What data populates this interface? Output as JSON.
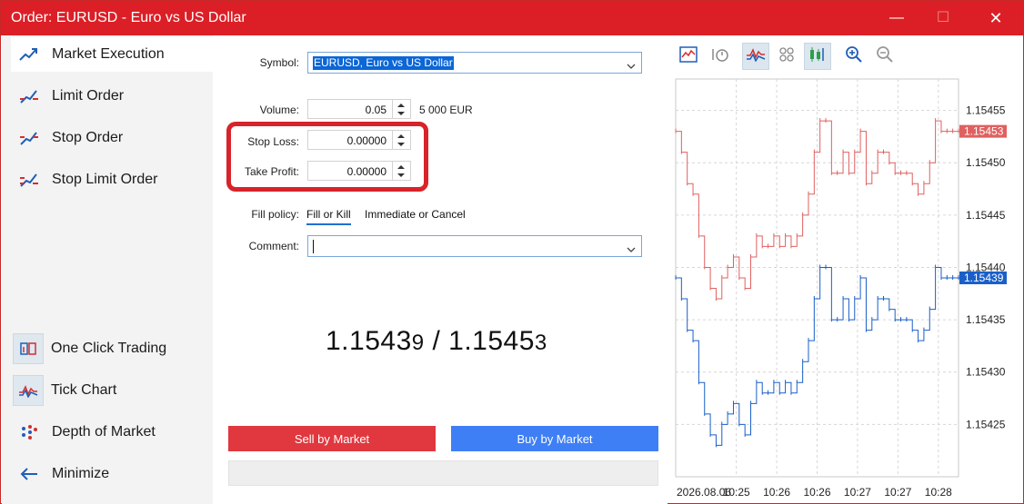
{
  "window": {
    "title": "Order: EURUSD - Euro vs US Dollar",
    "min_glyph": "—",
    "max_glyph": "☐",
    "close_glyph": "✕"
  },
  "sidebar": {
    "items": [
      {
        "label": "Market Execution",
        "icon": "market-execution-icon"
      },
      {
        "label": "Limit Order",
        "icon": "limit-order-icon"
      },
      {
        "label": "Stop Order",
        "icon": "stop-order-icon"
      },
      {
        "label": "Stop Limit Order",
        "icon": "stop-limit-order-icon"
      }
    ],
    "bottom_items": [
      {
        "label": "One Click Trading",
        "icon": "one-click-trading-icon"
      },
      {
        "label": "Tick Chart",
        "icon": "tick-chart-icon"
      },
      {
        "label": "Depth of Market",
        "icon": "depth-of-market-icon"
      },
      {
        "label": "Minimize",
        "icon": "arrow-left-icon"
      }
    ]
  },
  "form": {
    "symbol_label": "Symbol:",
    "symbol_value": "EURUSD, Euro vs US Dollar",
    "volume_label": "Volume:",
    "volume_value": "0.05",
    "volume_note": "5 000 EUR",
    "stop_loss_label": "Stop Loss:",
    "stop_loss_value": "0.00000",
    "take_profit_label": "Take Profit:",
    "take_profit_value": "0.00000",
    "fill_policy_label": "Fill policy:",
    "fill_options": [
      "Fill or Kill",
      "Immediate or Cancel"
    ],
    "comment_label": "Comment:",
    "comment_value": "",
    "bid_main": "1.1543",
    "bid_last": "9",
    "separator": " / ",
    "ask_main": "1.1545",
    "ask_last": "3",
    "sell_label": "Sell by Market",
    "buy_label": "Buy by Market"
  },
  "colors": {
    "title_bar": "#dc1f26",
    "ask_line": "#e06060",
    "bid_line": "#1a5fc8",
    "sell": "#e0383e",
    "buy": "#3f7ff5"
  },
  "chart_data": {
    "type": "line",
    "title": "",
    "y_ticks": [
      "1.15455",
      "1.15450",
      "1.15445",
      "1.15440",
      "1.15435",
      "1.15430",
      "1.15425"
    ],
    "x_ticks": [
      "2026.08.06",
      "10:25",
      "10:26",
      "10:26",
      "10:27",
      "10:27",
      "10:28"
    ],
    "ylim": [
      1.1542,
      1.15458
    ],
    "series": [
      {
        "name": "",
        "current_label": "1.15453",
        "values": [
          1.15453,
          1.15451,
          1.15448,
          1.15447,
          1.15443,
          1.1544,
          1.15438,
          1.15437,
          1.15439,
          1.1544,
          1.15441,
          1.15439,
          1.15438,
          1.15441,
          1.15443,
          1.15442,
          1.15442,
          1.15443,
          1.15442,
          1.15443,
          1.15442,
          1.15443,
          1.15445,
          1.15447,
          1.15451,
          1.15454,
          1.15454,
          1.15449,
          1.15449,
          1.15451,
          1.15449,
          1.15451,
          1.15453,
          1.15448,
          1.15449,
          1.15451,
          1.15451,
          1.1545,
          1.15449,
          1.15449,
          1.15449,
          1.15448,
          1.15447,
          1.15448,
          1.1545,
          1.15454,
          1.15453,
          1.15453,
          1.15453,
          1.15453
        ]
      },
      {
        "name": "",
        "current_label": "1.15439",
        "values": [
          1.15439,
          1.15437,
          1.15434,
          1.15433,
          1.15429,
          1.15426,
          1.15424,
          1.15423,
          1.15425,
          1.15426,
          1.15427,
          1.15425,
          1.15424,
          1.15427,
          1.15429,
          1.15428,
          1.15428,
          1.15429,
          1.15428,
          1.15429,
          1.15428,
          1.15429,
          1.15431,
          1.15433,
          1.15437,
          1.1544,
          1.1544,
          1.15435,
          1.15435,
          1.15437,
          1.15435,
          1.15437,
          1.15439,
          1.15434,
          1.15435,
          1.15437,
          1.15437,
          1.15436,
          1.15435,
          1.15435,
          1.15435,
          1.15434,
          1.15433,
          1.15434,
          1.15436,
          1.1544,
          1.15439,
          1.15439,
          1.15439,
          1.15439
        ]
      }
    ],
    "grid": true,
    "legend": "none"
  }
}
